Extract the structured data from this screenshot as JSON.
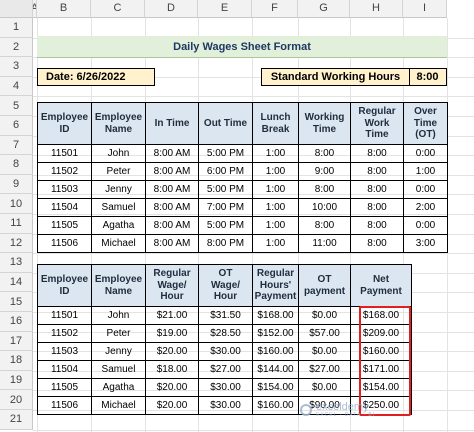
{
  "columns": [
    "A",
    "B",
    "C",
    "D",
    "E",
    "F",
    "G",
    "H",
    "I"
  ],
  "rows": [
    "1",
    "2",
    "3",
    "4",
    "5",
    "6",
    "7",
    "8",
    "9",
    "10",
    "11",
    "12",
    "13",
    "14",
    "15",
    "16",
    "17",
    "18",
    "19",
    "20",
    "21"
  ],
  "title": "Daily Wages Sheet Format",
  "date_label": "Date: 6/26/2022",
  "standard_hours": {
    "label": "Standard Working Hours",
    "value": "8:00"
  },
  "table1": {
    "headers": [
      [
        "Employee",
        "ID"
      ],
      [
        "Employee",
        "Name"
      ],
      [
        "In Time"
      ],
      [
        "Out Time"
      ],
      [
        "Lunch",
        "Break"
      ],
      [
        "Working",
        "Time"
      ],
      [
        "Regular",
        "Work",
        "Time"
      ],
      [
        "Over",
        "Time",
        "(OT)"
      ]
    ],
    "rows": [
      [
        "11501",
        "John",
        "8:00 AM",
        "5:00 PM",
        "1:00",
        "8:00",
        "8:00",
        "0:00"
      ],
      [
        "11502",
        "Peter",
        "8:00 AM",
        "6:00 PM",
        "1:00",
        "9:00",
        "8:00",
        "1:00"
      ],
      [
        "11503",
        "Jenny",
        "8:00 AM",
        "5:00 PM",
        "1:00",
        "8:00",
        "8:00",
        "0:00"
      ],
      [
        "11504",
        "Samuel",
        "8:00 AM",
        "7:00 PM",
        "1:00",
        "10:00",
        "8:00",
        "2:00"
      ],
      [
        "11505",
        "Agatha",
        "8:00 AM",
        "5:00 PM",
        "1:00",
        "8:00",
        "8:00",
        "0:00"
      ],
      [
        "11506",
        "Michael",
        "8:00 AM",
        "8:00 PM",
        "1:00",
        "11:00",
        "8:00",
        "3:00"
      ]
    ]
  },
  "table2": {
    "headers": [
      [
        "Employee",
        "ID"
      ],
      [
        "Employee",
        "Name"
      ],
      [
        "Regular",
        "Wage/",
        "Hour"
      ],
      [
        "OT",
        "Wage/",
        "Hour"
      ],
      [
        "Regular",
        "Hours'",
        "Payment"
      ],
      [
        "OT",
        "payment"
      ],
      [
        "Net",
        "Payment"
      ]
    ],
    "rows": [
      [
        "11501",
        "John",
        "$21.00",
        "$31.50",
        "$168.00",
        "$0.00",
        "$168.00"
      ],
      [
        "11502",
        "Peter",
        "$19.00",
        "$28.50",
        "$152.00",
        "$57.00",
        "$209.00"
      ],
      [
        "11503",
        "Jenny",
        "$20.00",
        "$30.00",
        "$160.00",
        "$0.00",
        "$160.00"
      ],
      [
        "11504",
        "Samuel",
        "$18.00",
        "$27.00",
        "$144.00",
        "$27.00",
        "$171.00"
      ],
      [
        "11505",
        "Agatha",
        "$20.00",
        "$30.00",
        "$154.00",
        "$0.00",
        "$154.00"
      ],
      [
        "11506",
        "Michael",
        "$20.00",
        "$30.00",
        "$160.00",
        "$90.00",
        "$250.00"
      ]
    ]
  },
  "watermark": {
    "name": "exceldemy",
    "tagline": "EXCEL · DATA · BI"
  },
  "colors": {
    "header_fill": "#dce6f1",
    "title_fill": "#e2efda",
    "date_fill": "#fff2cc",
    "highlight_border": "#e02020"
  }
}
